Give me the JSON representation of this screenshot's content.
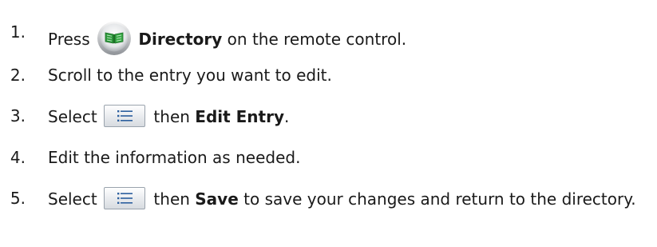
{
  "steps": [
    {
      "number": "1.",
      "pre": "Press",
      "icon": "directory-button-icon",
      "bold": "Directory",
      "post": " on the remote control."
    },
    {
      "number": "2.",
      "text": "Scroll to the entry you want to edit."
    },
    {
      "number": "3.",
      "pre": "Select",
      "icon": "menu-list-icon",
      "mid": "then",
      "bold": "Edit Entry",
      "post": "."
    },
    {
      "number": "4.",
      "text": "Edit the information as needed."
    },
    {
      "number": "5.",
      "pre": "Select",
      "icon": "menu-list-icon",
      "mid": "then",
      "bold": "Save",
      "post": " to save your changes and return to the directory."
    }
  ],
  "colors": {
    "text": "#1a1a1a",
    "directory_icon_green": "#2e9a3c"
  }
}
